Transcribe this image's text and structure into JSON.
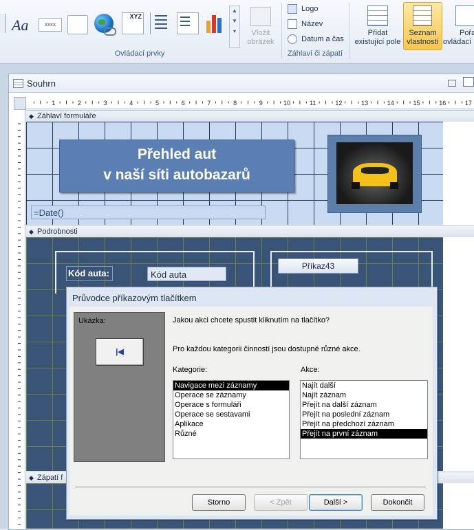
{
  "ribbon": {
    "controls_group_label": "Ovládací prvky",
    "insert_image_label_1": "Vložit",
    "insert_image_label_2": "obrázek",
    "header_footer_group_label": "Záhlaví či zápatí",
    "logo_label": "Logo",
    "title_label": "Název",
    "date_time_label": "Datum a čas",
    "add_field_label_1": "Přidat",
    "add_field_label_2": "existující pole",
    "property_sheet_label_1": "Seznam",
    "property_sheet_label_2": "vlastností",
    "tab_order_label_1": "Pořa",
    "tab_order_label_2": "ovládací",
    "label_icon_text": "Aa",
    "textbox_icon_text": "xxxx",
    "xyz_icon_text": "XYZ"
  },
  "form": {
    "title": "Souhrn",
    "ruler_numbers": [
      "1",
      "2",
      "3",
      "4",
      "5",
      "6",
      "7",
      "8",
      "9",
      "10",
      "11",
      "12",
      "13",
      "14",
      "15",
      "16",
      "17"
    ],
    "header_band": "Záhlaví formuláře",
    "title_line1": "Přehled aut",
    "title_line2": "v naší síti autobazarů",
    "date_field": "=Date()",
    "detail_band": "Podrobnosti",
    "car_code_label": "Kód auta:",
    "car_code_field": "Kód auta",
    "command_button": "Příkaz43",
    "footer_band": "Zápatí f"
  },
  "dialog": {
    "title": "Průvodce příkazovým tlačítkem",
    "sample_label": "Ukázka:",
    "question": "Jakou akci chcete spustit kliknutím na tlačítko?",
    "info": "Pro každou kategorii činností jsou dostupné různé akce.",
    "categories_label": "Kategorie:",
    "actions_label": "Akce:",
    "categories": [
      "Navigace mezi záznamy",
      "Operace se záznamy",
      "Operace s formuláři",
      "Operace se sestavami",
      "Aplikace",
      "Různé"
    ],
    "actions": [
      "Najít další",
      "Najít záznam",
      "Přejít na další záznam",
      "Přejít na poslední záznam",
      "Přejít na předchozí záznam",
      "Přejít na první záznam"
    ],
    "selected_category": 0,
    "selected_action": 5,
    "cancel_button": "Storno",
    "back_button": "< Zpět",
    "next_button": "Další >",
    "finish_button": "Dokončit"
  },
  "colors": {
    "title_box": "#5b7fb3",
    "detail_grid": "#3a5478",
    "header_grid": "#c8d9f2"
  }
}
